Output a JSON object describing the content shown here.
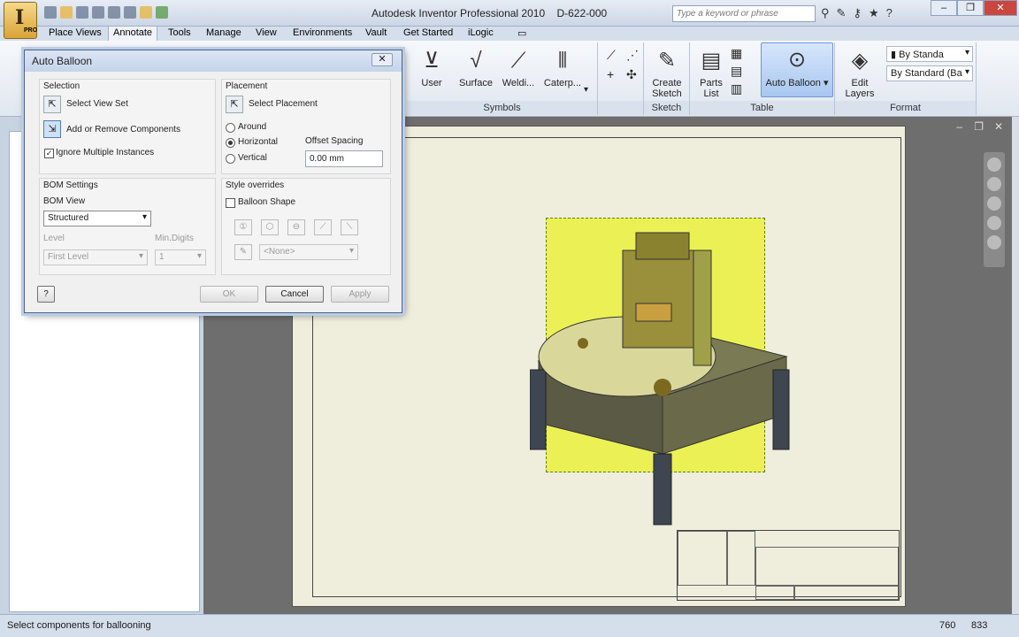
{
  "app": {
    "title": "Autodesk Inventor Professional 2010",
    "document": "D-622-000",
    "badge": "PRO"
  },
  "search": {
    "placeholder": "Type a keyword or phrase"
  },
  "menus": [
    "Place Views",
    "Annotate",
    "Tools",
    "Manage",
    "View",
    "Environments",
    "Vault",
    "Get Started",
    "iLogic"
  ],
  "active_menu": "Annotate",
  "ribbon": {
    "symbols": {
      "label": "Symbols",
      "items": [
        "User",
        "Surface",
        "Weldi...",
        "Caterp..."
      ]
    },
    "sketch": {
      "label": "Sketch",
      "items": [
        "Create Sketch"
      ]
    },
    "table": {
      "label": "Table",
      "items": [
        "Parts List",
        "Auto Balloon"
      ]
    },
    "format": {
      "label": "Format",
      "items": [
        "Edit Layers"
      ],
      "style1": "By Standa",
      "style2": "By Standard (Ba"
    }
  },
  "dialog": {
    "title": "Auto Balloon",
    "selection": {
      "heading": "Selection",
      "select_view_set": "Select View Set",
      "add_remove": "Add or Remove Components",
      "ignore_multiple": "Ignore Multiple Instances"
    },
    "placement": {
      "heading": "Placement",
      "select_placement": "Select Placement",
      "around": "Around",
      "horizontal": "Horizontal",
      "vertical": "Vertical",
      "offset_label": "Offset Spacing",
      "offset_value": "0.00 mm"
    },
    "bom": {
      "heading": "BOM Settings",
      "view_label": "BOM View",
      "view_value": "Structured",
      "level_label": "Level",
      "level_value": "First Level",
      "digits_label": "Min.Digits",
      "digits_value": "1"
    },
    "style": {
      "heading": "Style overrides",
      "balloon_shape": "Balloon Shape",
      "none_value": "<None>"
    },
    "buttons": {
      "ok": "OK",
      "cancel": "Cancel",
      "apply": "Apply",
      "help": "?"
    }
  },
  "status": {
    "message": "Select components for ballooning",
    "x": "760",
    "y": "833"
  },
  "colors": {
    "highlight": "#eaf13c",
    "accent": "#6f97cf",
    "sheet": "#efeedd"
  }
}
